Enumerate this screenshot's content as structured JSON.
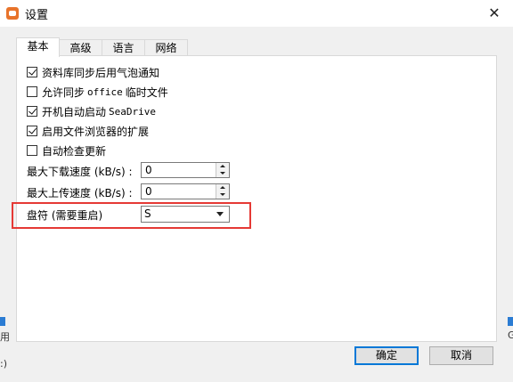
{
  "window": {
    "title": "设置",
    "close_glyph": "✕"
  },
  "tabs": [
    {
      "label": "基本",
      "active": true
    },
    {
      "label": "高级",
      "active": false
    },
    {
      "label": "语言",
      "active": false
    },
    {
      "label": "网络",
      "active": false
    }
  ],
  "options": [
    {
      "label": "资料库同步后用气泡通知",
      "checked": true
    },
    {
      "label_prefix": "允许同步 ",
      "label_mono": "office",
      "label_suffix": " 临时文件",
      "checked": false
    },
    {
      "label_prefix": "开机自动启动 ",
      "label_mono": "SeaDrive",
      "label_suffix": "",
      "checked": true
    },
    {
      "label": "启用文件浏览器的扩展",
      "checked": true
    },
    {
      "label": "自动检查更新",
      "checked": false
    }
  ],
  "download_speed": {
    "label": "最大下载速度 (kB/s) :",
    "value": "0"
  },
  "upload_speed": {
    "label": "最大上传速度 (kB/s) :",
    "value": "0"
  },
  "drive_letter": {
    "label": "盘符 (需要重启)",
    "value": "S"
  },
  "buttons": {
    "ok": "确定",
    "cancel": "取消"
  },
  "colors": {
    "highlight": "#e53935",
    "primary_border": "#0078d7",
    "app_icon": "#e8732a"
  },
  "background_fragments": {
    "left_char_1": "用",
    "left_char_2": ":)",
    "right_char": "G"
  }
}
